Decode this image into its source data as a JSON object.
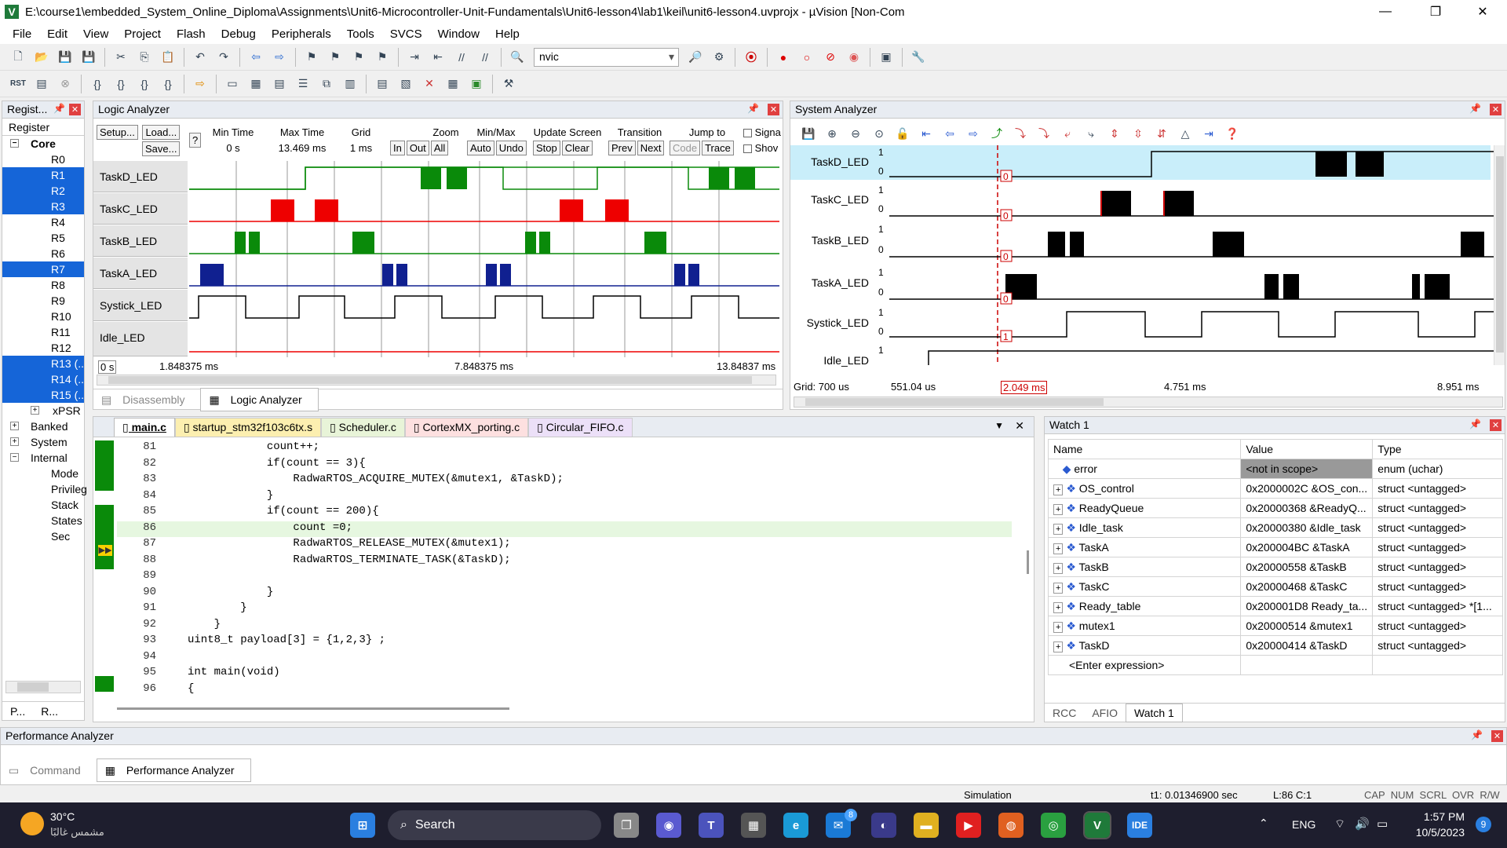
{
  "window": {
    "title": "E:\\course1\\embedded_System_Online_Diploma\\Assignments\\Unit6-Microcontroller-Unit-Fundamentals\\Unit6-lesson4\\lab1\\keil\\unit6-lesson4.uvprojx - µVision [Non-Com",
    "min": "—",
    "max": "❐",
    "close": "✕"
  },
  "menu": [
    "File",
    "Edit",
    "View",
    "Project",
    "Flash",
    "Debug",
    "Peripherals",
    "Tools",
    "SVCS",
    "Window",
    "Help"
  ],
  "toolbar": {
    "find_value": "nvic"
  },
  "registers": {
    "title": "Regist...",
    "header": "Register",
    "core": "Core",
    "items": [
      {
        "name": "R0",
        "sel": false
      },
      {
        "name": "R1",
        "sel": true
      },
      {
        "name": "R2",
        "sel": true
      },
      {
        "name": "R3",
        "sel": true
      },
      {
        "name": "R4",
        "sel": false
      },
      {
        "name": "R5",
        "sel": false
      },
      {
        "name": "R6",
        "sel": false
      },
      {
        "name": "R7",
        "sel": true
      },
      {
        "name": "R8",
        "sel": false
      },
      {
        "name": "R9",
        "sel": false
      },
      {
        "name": "R10",
        "sel": false
      },
      {
        "name": "R11",
        "sel": false
      },
      {
        "name": "R12",
        "sel": false
      },
      {
        "name": "R13 (..",
        "sel": true
      },
      {
        "name": "R14 (..",
        "sel": true
      },
      {
        "name": "R15 (..",
        "sel": true
      }
    ],
    "xpsr": "xPSR",
    "banked": "Banked",
    "system": "System",
    "internal": "Internal",
    "internal_items": [
      "Mode",
      "Privileg",
      "Stack",
      "States",
      "Sec"
    ],
    "tab1": "P...",
    "tab2": "R..."
  },
  "logic": {
    "title": "Logic Analyzer",
    "setup": "Setup...",
    "load": "Load...",
    "save": "Save...",
    "help": "?",
    "min_time_label": "Min Time",
    "min_time": "0 s",
    "max_time_label": "Max Time",
    "max_time": "13.469 ms",
    "grid_label": "Grid",
    "grid": "1 ms",
    "zoom_label": "Zoom",
    "zoom_in": "In",
    "zoom_out": "Out",
    "zoom_all": "All",
    "minmax_label": "Min/Max",
    "auto": "Auto",
    "undo": "Undo",
    "update_label": "Update Screen",
    "stop": "Stop",
    "clear": "Clear",
    "transition_label": "Transition",
    "prev": "Prev",
    "next": "Next",
    "jump_label": "Jump to",
    "code": "Code",
    "trace": "Trace",
    "signal_chk": "Signa",
    "show_chk": "Shov",
    "signals": [
      "TaskD_LED",
      "TaskC_LED",
      "TaskB_LED",
      "TaskA_LED",
      "Systick_LED",
      "Idle_LED"
    ],
    "axis_start": "0 s",
    "t1": "1.848375 ms",
    "t2": "7.848375 ms",
    "t3": "13.84837 ms",
    "tab_disasm": "Disassembly",
    "tab_logic": "Logic Analyzer"
  },
  "system_analyzer": {
    "title": "System Analyzer",
    "signals": [
      "TaskD_LED",
      "TaskC_LED",
      "TaskB_LED",
      "TaskA_LED",
      "Systick_LED",
      "Idle_LED"
    ],
    "one": "1",
    "zero": "0",
    "grid": "Grid: 700 us",
    "t0": "551.04 us",
    "cursor": "2.049 ms",
    "t1": "4.751 ms",
    "t2": "8.951 ms",
    "marker0": "0",
    "marker1": "1"
  },
  "editor": {
    "tabs": [
      "main.c",
      "startup_stm32f103c6tx.s",
      "Scheduler.c",
      "CortexMX_porting.c",
      "Circular_FIFO.c"
    ],
    "lines": [
      {
        "n": "81",
        "t": "            count++;"
      },
      {
        "n": "82",
        "t": "            if(count == 3){"
      },
      {
        "n": "83",
        "t": "                RadwaRTOS_ACQUIRE_MUTEX(&mutex1, &TaskD);"
      },
      {
        "n": "84",
        "t": "            }"
      },
      {
        "n": "85",
        "t": "            if(count == 200){"
      },
      {
        "n": "86",
        "t": "                count =0;"
      },
      {
        "n": "87",
        "t": "                RadwaRTOS_RELEASE_MUTEX(&mutex1);"
      },
      {
        "n": "88",
        "t": "                RadwaRTOS_TERMINATE_TASK(&TaskD);"
      },
      {
        "n": "89",
        "t": ""
      },
      {
        "n": "90",
        "t": "            }"
      },
      {
        "n": "91",
        "t": "        }"
      },
      {
        "n": "92",
        "t": "    }"
      },
      {
        "n": "93",
        "t": "uint8_t payload[3] = {1,2,3} ;"
      },
      {
        "n": "94",
        "t": ""
      },
      {
        "n": "95",
        "t": "int main(void)"
      },
      {
        "n": "96",
        "t": "{"
      }
    ]
  },
  "watch": {
    "title": "Watch 1",
    "col_name": "Name",
    "col_value": "Value",
    "col_type": "Type",
    "rows": [
      {
        "name": "error",
        "value": "<not in scope>",
        "type": "enum (uchar)"
      },
      {
        "name": "OS_control",
        "value": "0x2000002C &OS_con...",
        "type": "struct <untagged>"
      },
      {
        "name": "ReadyQueue",
        "value": "0x20000368 &ReadyQ...",
        "type": "struct <untagged>"
      },
      {
        "name": "Idle_task",
        "value": "0x20000380 &Idle_task",
        "type": "struct <untagged>"
      },
      {
        "name": "TaskA",
        "value": "0x200004BC &TaskA",
        "type": "struct <untagged>"
      },
      {
        "name": "TaskB",
        "value": "0x20000558 &TaskB",
        "type": "struct <untagged>"
      },
      {
        "name": "TaskC",
        "value": "0x20000468 &TaskC",
        "type": "struct <untagged>"
      },
      {
        "name": "Ready_table",
        "value": "0x200001D8 Ready_ta...",
        "type": "struct <untagged> *[1..."
      },
      {
        "name": "mutex1",
        "value": "0x20000514 &mutex1",
        "type": "struct <untagged>"
      },
      {
        "name": "TaskD",
        "value": "0x20000414 &TaskD",
        "type": "struct <untagged>"
      }
    ],
    "enter": "<Enter expression>",
    "tabs": [
      "RCC",
      "AFIO",
      "Watch 1"
    ]
  },
  "perf": {
    "title": "Performance Analyzer",
    "tab_command": "Command",
    "tab_perf": "Performance Analyzer"
  },
  "status": {
    "mode": "Simulation",
    "t1": "t1: 0.01346900 sec",
    "pos": "L:86 C:1",
    "flags": "CAP  NUM  SCRL  OVR  R/W"
  },
  "taskbar": {
    "temp": "30°C",
    "weather": "مشمس غالبًا",
    "search": "Search",
    "lang": "ENG",
    "time": "1:57 PM",
    "date": "10/5/2023",
    "mail_badge": "8",
    "notif": "9"
  }
}
